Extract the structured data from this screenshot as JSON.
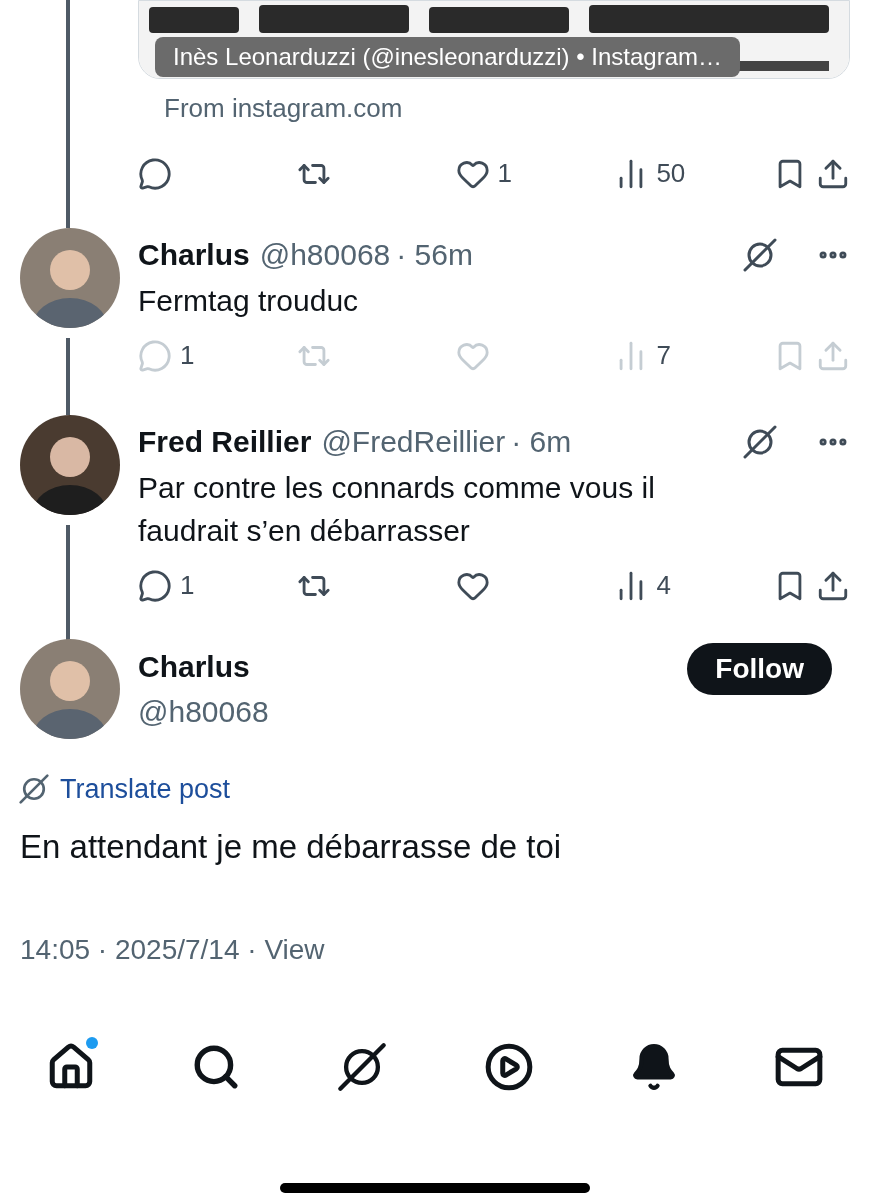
{
  "link_card": {
    "caption": "Inès Leonarduzzi (@inesleonarduzzi) • Instagram…",
    "source": "From instagram.com",
    "actions": [
      {
        "kind": "reply"
      },
      {
        "kind": "repost"
      },
      {
        "kind": "like",
        "count": "1"
      },
      {
        "kind": "views",
        "count": "50"
      },
      {
        "kind": "bookmark"
      },
      {
        "kind": "share"
      }
    ]
  },
  "replies": [
    {
      "name": "Charlus",
      "handle": "@h80068",
      "time": "· 56m",
      "text": "Fermtag trouduc",
      "disabled": true,
      "actions": [
        {
          "kind": "reply",
          "count": "1"
        },
        {
          "kind": "repost"
        },
        {
          "kind": "like"
        },
        {
          "kind": "views",
          "count": "7"
        },
        {
          "kind": "bookmark"
        },
        {
          "kind": "share"
        }
      ]
    },
    {
      "name": "Fred Reillier",
      "handle": "@FredReillier",
      "time": "· 6m",
      "text": "Par contre les connards comme vous il faudrait s’en débarrasser",
      "disabled": false,
      "actions": [
        {
          "kind": "reply",
          "count": "1"
        },
        {
          "kind": "repost"
        },
        {
          "kind": "like"
        },
        {
          "kind": "views",
          "count": "4"
        },
        {
          "kind": "bookmark"
        },
        {
          "kind": "share"
        }
      ]
    }
  ],
  "main_post": {
    "name": "Charlus",
    "handle": "@h80068",
    "follow": "Follow",
    "translate": "Translate post",
    "text": "En attendant je me débarrasse de toi",
    "meta": "14:05 · 2025/7/14 · View"
  },
  "nav": [
    {
      "kind": "home",
      "unread": true
    },
    {
      "kind": "search",
      "unread": false
    },
    {
      "kind": "grok",
      "unread": false
    },
    {
      "kind": "video",
      "unread": false
    },
    {
      "kind": "notifications",
      "unread": false
    },
    {
      "kind": "messages",
      "unread": false
    }
  ]
}
